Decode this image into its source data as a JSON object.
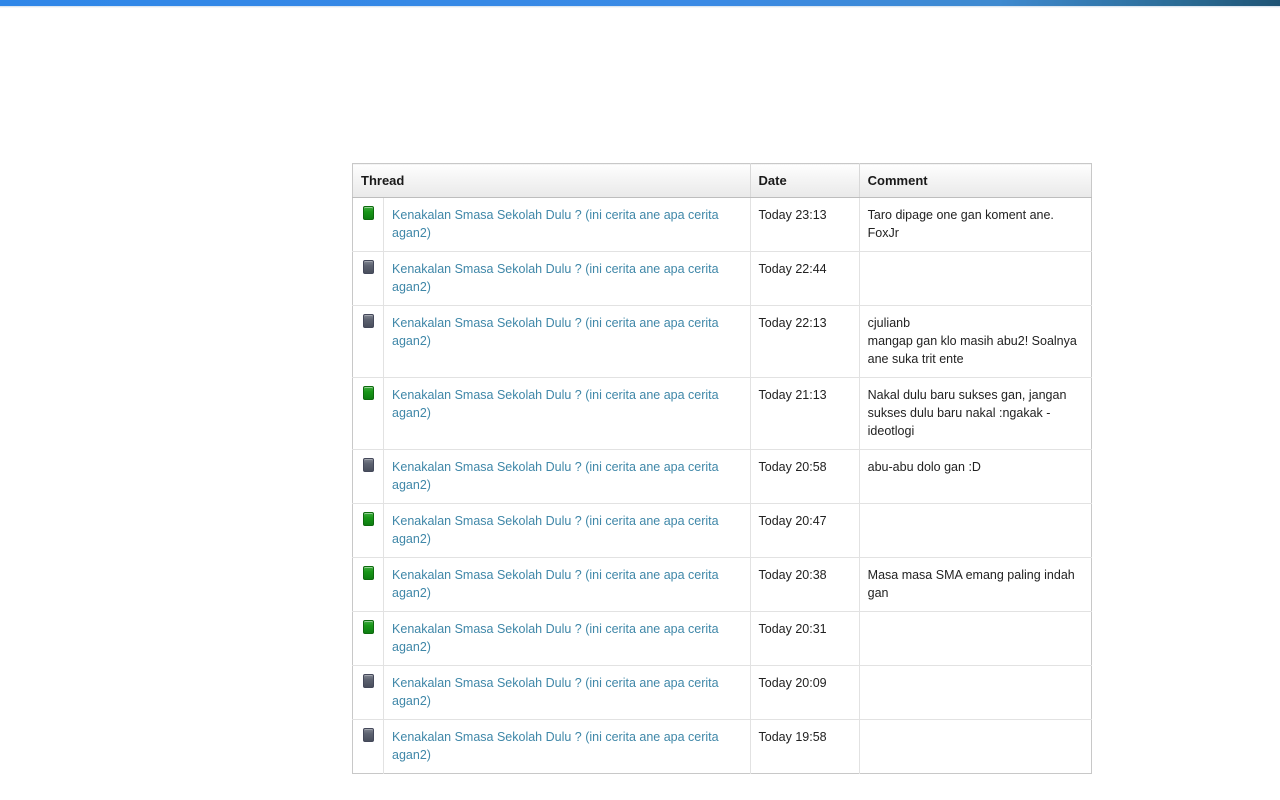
{
  "top_bar": {
    "accent_color": "#2f87e8",
    "accent_color_right": "#1f5475"
  },
  "table": {
    "columns": {
      "icon": "",
      "thread": "Thread",
      "date": "Date",
      "comment": "Comment"
    },
    "icon_colors": {
      "new": "#179617",
      "read": "#5d6270"
    },
    "link_color": "#3f87a8",
    "rows": [
      {
        "status": "new",
        "status_icon": "thread-status-new-icon",
        "thread": "Kenakalan Smasa Sekolah Dulu ? (ini cerita ane apa cerita agan2)",
        "date": "Today 23:13",
        "comment_lines": [
          "Taro dipage one gan koment ane. FoxJr"
        ]
      },
      {
        "status": "read",
        "status_icon": "thread-status-read-icon",
        "thread": "Kenakalan Smasa Sekolah Dulu ? (ini cerita ane apa cerita agan2)",
        "date": "Today 22:44",
        "comment_lines": []
      },
      {
        "status": "read",
        "status_icon": "thread-status-read-icon",
        "thread": "Kenakalan Smasa Sekolah Dulu ? (ini cerita ane apa cerita agan2)",
        "date": "Today 22:13",
        "comment_lines": [
          "cjulianb",
          "mangap gan klo masih abu2! Soalnya ane suka trit ente"
        ]
      },
      {
        "status": "new",
        "status_icon": "thread-status-new-icon",
        "thread": "Kenakalan Smasa Sekolah Dulu ? (ini cerita ane apa cerita agan2)",
        "date": "Today 21:13",
        "comment_lines": [
          "Nakal dulu baru sukses gan, jangan sukses dulu baru nakal :ngakak - ideotlogi"
        ]
      },
      {
        "status": "read",
        "status_icon": "thread-status-read-icon",
        "thread": "Kenakalan Smasa Sekolah Dulu ? (ini cerita ane apa cerita agan2)",
        "date": "Today 20:58",
        "comment_lines": [
          "abu-abu dolo gan :D"
        ]
      },
      {
        "status": "new",
        "status_icon": "thread-status-new-icon",
        "thread": "Kenakalan Smasa Sekolah Dulu ? (ini cerita ane apa cerita agan2)",
        "date": "Today 20:47",
        "comment_lines": []
      },
      {
        "status": "new",
        "status_icon": "thread-status-new-icon",
        "thread": "Kenakalan Smasa Sekolah Dulu ? (ini cerita ane apa cerita agan2)",
        "date": "Today 20:38",
        "comment_lines": [
          "Masa masa SMA emang paling indah gan"
        ]
      },
      {
        "status": "new",
        "status_icon": "thread-status-new-icon",
        "thread": "Kenakalan Smasa Sekolah Dulu ? (ini cerita ane apa cerita agan2)",
        "date": "Today 20:31",
        "comment_lines": []
      },
      {
        "status": "read",
        "status_icon": "thread-status-read-icon",
        "thread": "Kenakalan Smasa Sekolah Dulu ? (ini cerita ane apa cerita agan2)",
        "date": "Today 20:09",
        "comment_lines": []
      },
      {
        "status": "read",
        "status_icon": "thread-status-read-icon",
        "thread": "Kenakalan Smasa Sekolah Dulu ? (ini cerita ane apa cerita agan2)",
        "date": "Today 19:58",
        "comment_lines": []
      }
    ]
  }
}
